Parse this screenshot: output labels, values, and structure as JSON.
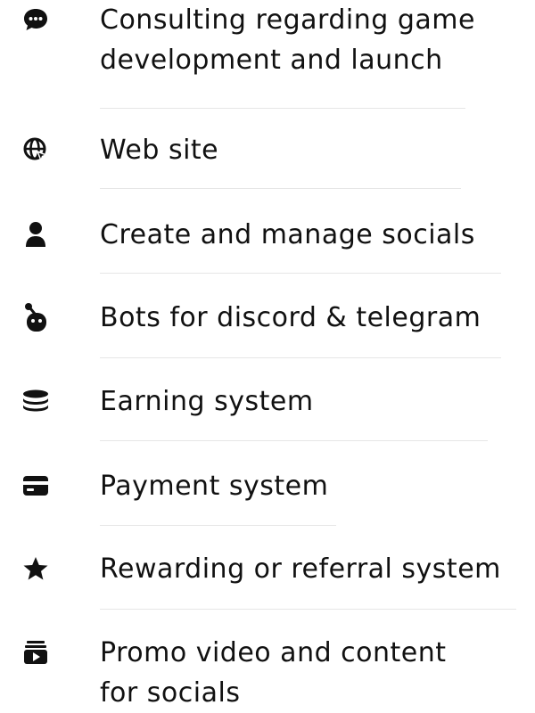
{
  "services": [
    {
      "icon": "chat-bubble-icon",
      "label": "Consulting regarding game development and launch"
    },
    {
      "icon": "globe-icon",
      "label": "Web site"
    },
    {
      "icon": "user-icon",
      "label": "Create and manage socials"
    },
    {
      "icon": "bot-icon",
      "label": "Bots for discord & telegram"
    },
    {
      "icon": "database-icon",
      "label": "Earning system"
    },
    {
      "icon": "credit-card-icon",
      "label": "Payment system"
    },
    {
      "icon": "star-icon",
      "label": "Rewarding or referral system"
    },
    {
      "icon": "video-library-icon",
      "label": "Promo video and content for socials"
    }
  ]
}
